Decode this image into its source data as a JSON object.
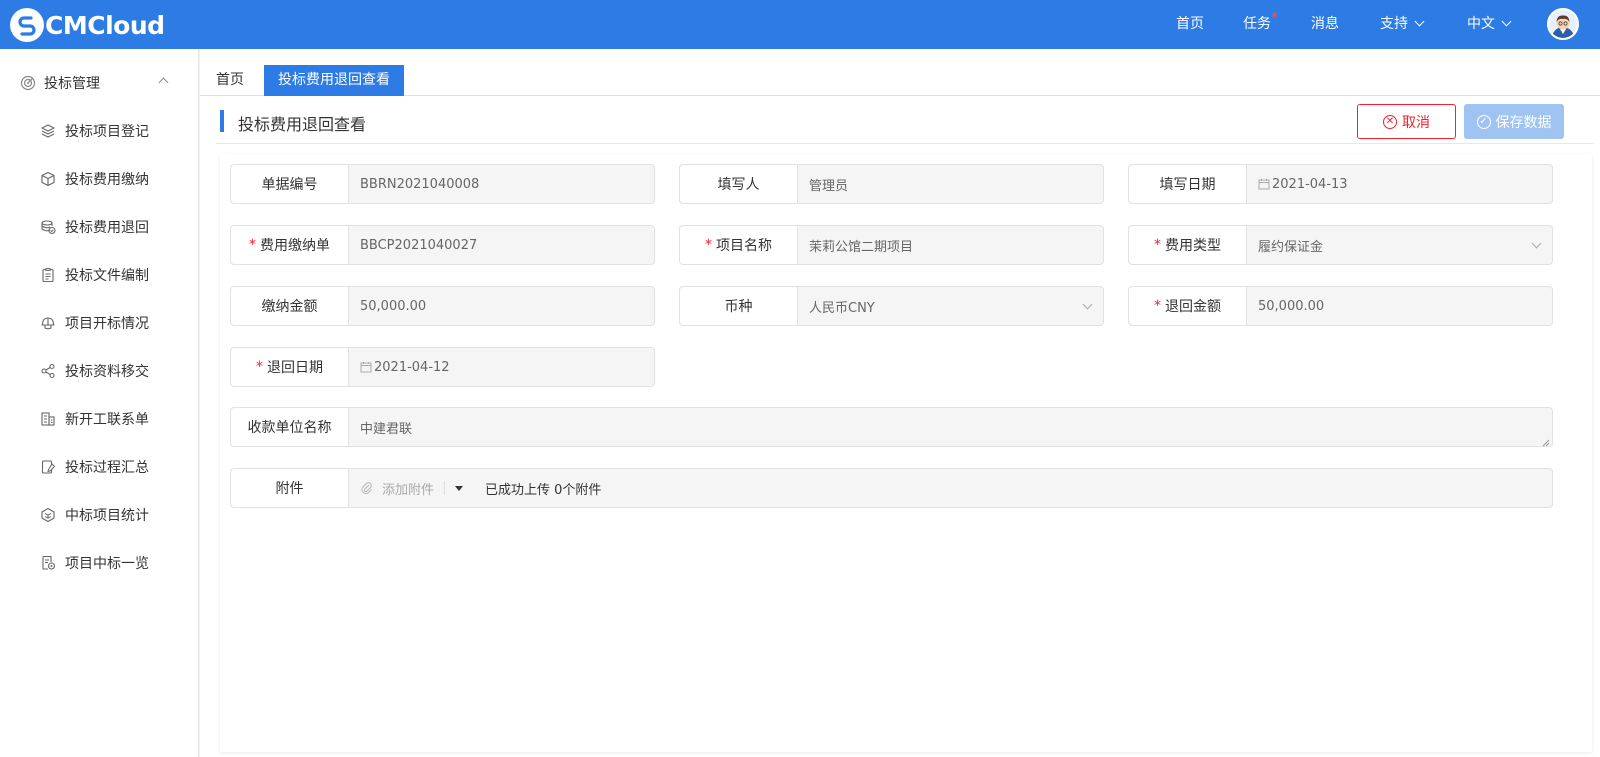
{
  "app": {
    "logo_text": "CMCloud"
  },
  "topnav": {
    "items": [
      {
        "label": "首页",
        "has_dot": false,
        "has_chevron": false
      },
      {
        "label": "任务",
        "has_dot": true,
        "has_chevron": false
      },
      {
        "label": "消息",
        "has_dot": false,
        "has_chevron": false
      },
      {
        "label": "支持",
        "has_dot": false,
        "has_chevron": true
      },
      {
        "label": "中文",
        "has_dot": false,
        "has_chevron": true
      }
    ],
    "task_dot": "*"
  },
  "sidebar": {
    "group": {
      "label": "投标管理",
      "icon": "target-icon",
      "expanded": true
    },
    "items": [
      {
        "label": "投标项目登记",
        "icon": "layers-icon"
      },
      {
        "label": "投标费用缴纳",
        "icon": "cube-icon"
      },
      {
        "label": "投标费用退回",
        "icon": "coins-return-icon"
      },
      {
        "label": "投标文件编制",
        "icon": "clipboard-icon"
      },
      {
        "label": "项目开标情况",
        "icon": "helmet-icon"
      },
      {
        "label": "投标资料移交",
        "icon": "share-icon"
      },
      {
        "label": "新开工联系单",
        "icon": "building-icon"
      },
      {
        "label": "投标过程汇总",
        "icon": "notebook-edit-icon"
      },
      {
        "label": "中标项目统计",
        "icon": "hexagon-icon"
      },
      {
        "label": "项目中标一览",
        "icon": "document-seal-icon"
      }
    ]
  },
  "tabs": {
    "home": "首页",
    "active": "投标费用退回查看"
  },
  "page": {
    "title": "投标费用退回查看",
    "cancel_label": "取消",
    "save_label": "保存数据"
  },
  "form": {
    "doc_no": {
      "label": "单据编号",
      "value": "BBRN2021040008",
      "required": false
    },
    "filler": {
      "label": "填写人",
      "value": "管理员",
      "required": false
    },
    "fill_date": {
      "label": "填写日期",
      "value": "2021-04-13",
      "required": false
    },
    "payment_doc": {
      "label": "费用缴纳单",
      "value": "BBCP2021040027",
      "required": true
    },
    "project_name": {
      "label": "项目名称",
      "value": "茉莉公馆二期项目",
      "required": true
    },
    "fee_type": {
      "label": "费用类型",
      "value": "履约保证金",
      "required": true
    },
    "paid_amount": {
      "label": "缴纳金额",
      "value": "50,000.00",
      "required": false
    },
    "currency": {
      "label": "币种",
      "value": "人民币CNY",
      "required": false
    },
    "return_amount": {
      "label": "退回金额",
      "value": "50,000.00",
      "required": true
    },
    "return_date": {
      "label": "退回日期",
      "value": "2021-04-12",
      "required": true
    },
    "payee": {
      "label": "收款单位名称",
      "value": "中建君联",
      "required": false
    },
    "attachment": {
      "label": "附件",
      "add_label": "添加附件",
      "status": "已成功上传 0个附件"
    },
    "required_mark": "*"
  },
  "colors": {
    "primary": "#2d7be5",
    "danger": "#f5222d",
    "save_disabled": "#9fc4f2"
  }
}
